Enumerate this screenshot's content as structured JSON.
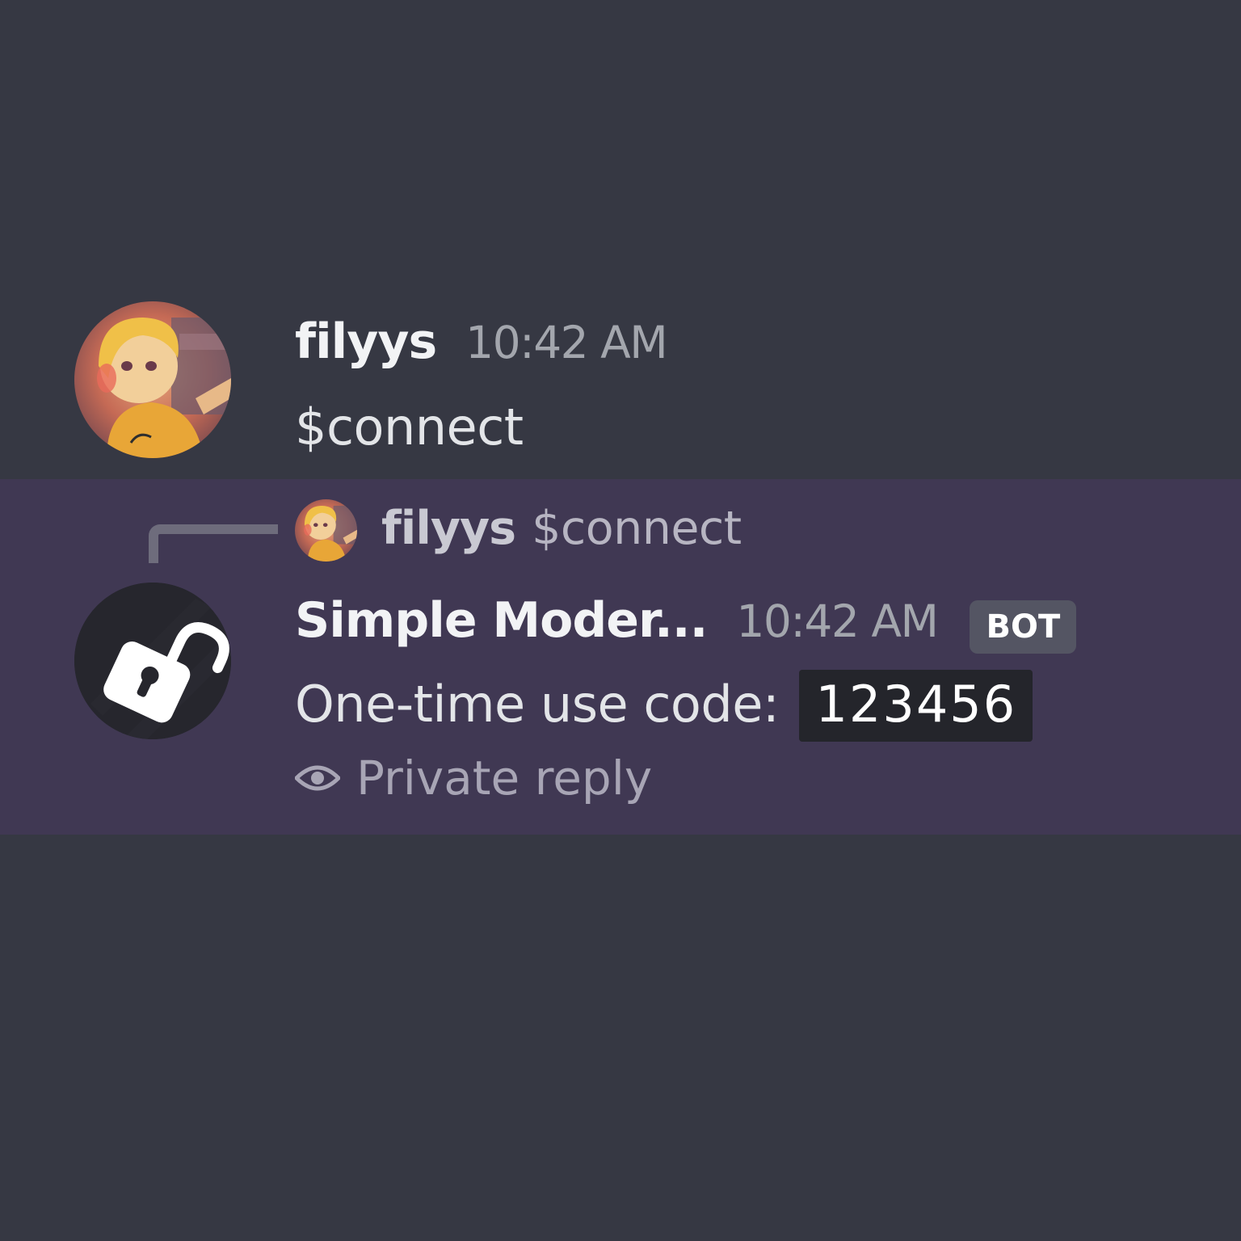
{
  "messages": [
    {
      "author": "filyys",
      "timestamp": "10:42 AM",
      "content": "$connect",
      "avatar_icon": "user-avatar"
    },
    {
      "author": "Simple Moder...",
      "timestamp": "10:42 AM",
      "badge": "BOT",
      "avatar_icon": "open-padlock-icon",
      "reply_to": {
        "author": "filyys",
        "content": "$connect"
      },
      "content_prefix": "One-time use code:",
      "code": "123456",
      "footer": "Private reply",
      "footer_icon": "eye-icon",
      "highlight_color": "#403853"
    }
  ],
  "colors": {
    "background": "#363843",
    "highlight": "#403853",
    "username": "#f2f3f5",
    "timestamp": "#a3a6ad",
    "badge_bg": "#545563",
    "code_bg": "#24252b"
  }
}
